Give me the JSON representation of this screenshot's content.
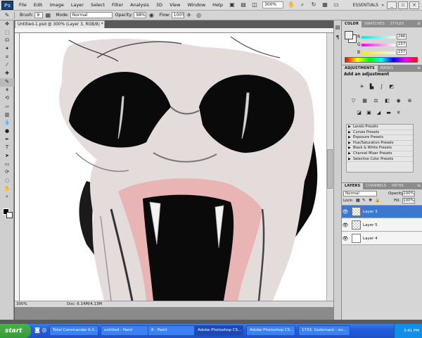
{
  "menu": {
    "logo": "Ps",
    "items": [
      "File",
      "Edit",
      "Image",
      "Layer",
      "Select",
      "Filter",
      "Analysis",
      "3D",
      "View",
      "Window",
      "Help"
    ],
    "zoom": "300%",
    "workspace": "ESSENTIALS"
  },
  "options": {
    "brush_label": "Brush:",
    "brush_size": "9",
    "mode_label": "Mode:",
    "mode_value": "Normal",
    "opacity_label": "Opacity:",
    "opacity_value": "98%",
    "flow_label": "Flow:",
    "flow_value": "100%"
  },
  "document": {
    "tab_title": "Untitled-1.psd @ 300% (Layer 3, RGB/8) *",
    "status_zoom": "300%",
    "status_doc": "Doc: 6.14M/4.13M"
  },
  "color_panel": {
    "tabs": [
      "COLOR",
      "SWATCHES",
      "STYLES"
    ],
    "r_label": "R",
    "g_label": "G",
    "b_label": "B",
    "r_value": "246",
    "g_value": "237",
    "b_value": "237"
  },
  "adjustments_panel": {
    "tabs": [
      "ADJUSTMENTS",
      "MASKS"
    ],
    "title": "Add an adjustment",
    "presets": [
      "Levels Presets",
      "Curves Presets",
      "Exposure Presets",
      "Hue/Saturation Presets",
      "Black & White Presets",
      "Channel Mixer Presets",
      "Selective Color Presets"
    ]
  },
  "layers_panel": {
    "tabs": [
      "LAYERS",
      "CHANNELS",
      "PATHS"
    ],
    "blend_mode": "Normal",
    "opacity_label": "Opacity:",
    "opacity_value": "100%",
    "lock_label": "Lock:",
    "fill_label": "Fill:",
    "fill_value": "100%",
    "layers": [
      {
        "name": "Layer 3",
        "selected": true
      },
      {
        "name": "Layer 5",
        "selected": false
      },
      {
        "name": "Layer 4",
        "selected": false
      }
    ]
  },
  "taskbar": {
    "start": "start",
    "tasks": [
      "Total Commander 6.0...",
      "untitled - Paint",
      "8 - Paint",
      "Adobe Photoshop CS...",
      "Adobe Photoshop CS...",
      "1733. Godsmack - ev..."
    ],
    "clock": "3:41 PM"
  },
  "colors": {
    "skin": "#e4dcdb",
    "mouth": "#e9b4b4",
    "dark": "#0a0a0a",
    "accent": "#3c78d0"
  }
}
